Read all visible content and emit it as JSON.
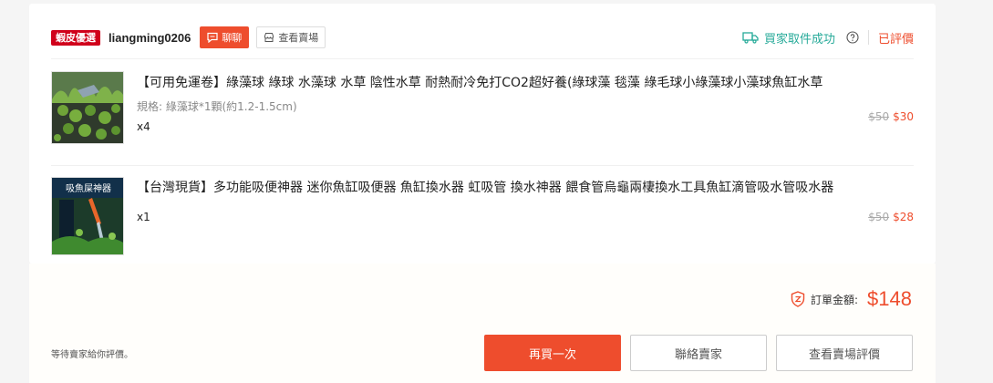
{
  "shop": {
    "badge": "蝦皮優選",
    "name": "liangming0206",
    "chat_label": "聊聊",
    "view_shop_label": "查看賣場"
  },
  "status": {
    "delivery_text": "買家取件成功",
    "rating_status": "已評價"
  },
  "items": [
    {
      "title": "【可用免運卷】綠藻球 綠球 水藻球 水草 陰性水草 耐熱耐冷免打CO2超好養(綠球藻 毯藻 綠毛球小綠藻球小藻球魚缸水草",
      "variation": "規格: 綠藻球*1顆(約1.2-1.5cm)",
      "quantity": "x4",
      "original_price": "$50",
      "price": "$30"
    },
    {
      "title": "【台灣現貨】多功能吸便神器 迷你魚缸吸便器 魚缸換水器 虹吸管 換水神器 餵食管烏龜兩棲換水工具魚缸滴管吸水管吸水器",
      "thumb_text": "吸魚屎神器",
      "quantity": "x1",
      "original_price": "$50",
      "price": "$28"
    }
  ],
  "summary": {
    "total_label": "訂單金額:",
    "total_value": "$148",
    "wait_note": "等待賣家給你評價。"
  },
  "actions": {
    "buy_again": "再買一次",
    "contact_seller": "聯絡賣家",
    "view_shop_reviews": "查看賣場評價"
  },
  "colors": {
    "accent": "#ee4d2d",
    "mall_badge": "#d0011b",
    "delivery": "#26aa99"
  }
}
